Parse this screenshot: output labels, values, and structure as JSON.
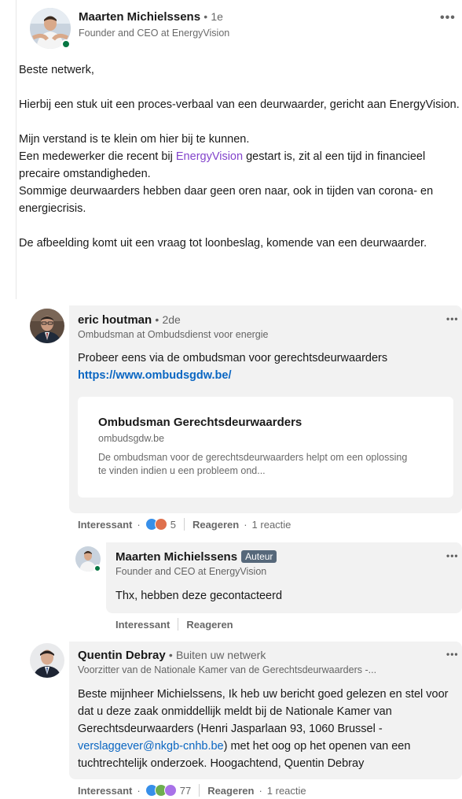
{
  "post": {
    "author": "Maarten Michielssens",
    "time": "1e",
    "headline": "Founder and CEO at EnergyVision",
    "paragraphs": {
      "p1": "Beste netwerk,",
      "p2": "Hierbij een stuk uit een proces-verbaal van een deurwaarder, gericht aan EnergyVision.",
      "p3a": "Mijn verstand is te klein om hier bij te kunnen.",
      "p3b_pre": "Een medewerker die recent bij ",
      "p3b_mention": "EnergyVision",
      "p3b_post": " gestart is, zit al een tijd in financieel precaire omstandigheden.",
      "p3c": "Sommige deurwaarders hebben daar geen oren naar, ook in tijden van corona- en energiecrisis.",
      "p4": "De afbeelding komt uit een vraag tot loonbeslag, komende van een deurwaarder."
    }
  },
  "comments": [
    {
      "author": "eric houtman",
      "time": "2de",
      "headline": "Ombudsman at Ombudsdienst voor energie",
      "text": "Probeer eens via de ombudsman voor gerechtsdeurwaarders",
      "link": "https://www.ombudsgdw.be/",
      "preview": {
        "title": "Ombudsman Gerechtsdeurwaarders",
        "domain": "ombudsgdw.be",
        "desc": "De ombudsman voor de gerechtsdeurwaarders helpt om een oplossing te vinden indien u een probleem ond..."
      },
      "actions": {
        "like": "Interessant",
        "reactions": "5",
        "reply": "Reageren",
        "replies": "1 reactie"
      }
    },
    {
      "author": "Maarten Michielssens",
      "badge": "Auteur",
      "headline": "Founder and CEO at EnergyVision",
      "text": "Thx, hebben deze gecontacteerd",
      "actions": {
        "like": "Interessant",
        "reply": "Reageren"
      }
    },
    {
      "author": "Quentin Debray",
      "time": "Buiten uw netwerk",
      "headline": "Voorzitter van de Nationale Kamer van de Gerechtsdeurwaarders -...",
      "text_pre": "Beste mijnheer Michielssens, Ik heb uw bericht goed gelezen en stel voor dat u deze zaak onmiddellijk meldt bij de Nationale Kamer van Gerechtsdeurwaarders (Henri Jasparlaan 93, 1060 Brussel - ",
      "email": "verslaggever@nkgb-cnhb.be",
      "text_post": ") met het oog op het openen van een tuchtrechtelijk onderzoek. Hoogachtend, Quentin Debray",
      "actions": {
        "like": "Interessant",
        "reactions": "77",
        "reply": "Reageren",
        "replies": "1 reactie"
      }
    }
  ],
  "ui": {
    "separator": "•",
    "more": "•••",
    "dot": "·"
  },
  "colors": {
    "mention": "#8344cc",
    "link": "#0a66c2",
    "online": "#057642",
    "bubble": "#f2f2f2",
    "like_blue": "#378fe9",
    "love_red": "#df704d",
    "celebrate_green": "#6dae4f"
  }
}
